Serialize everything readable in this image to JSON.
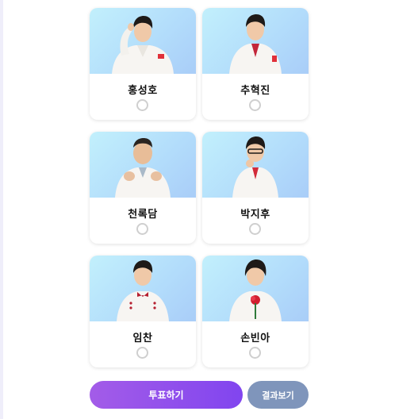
{
  "candidates": [
    {
      "name": "홍성호",
      "photo_icon": "candidate-photo",
      "selected": false
    },
    {
      "name": "추혁진",
      "photo_icon": "candidate-photo",
      "selected": false
    },
    {
      "name": "천록담",
      "photo_icon": "candidate-photo",
      "selected": false
    },
    {
      "name": "박지후",
      "photo_icon": "candidate-photo",
      "selected": false
    },
    {
      "name": "임찬",
      "photo_icon": "candidate-photo",
      "selected": false
    },
    {
      "name": "손빈아",
      "photo_icon": "candidate-photo",
      "selected": false
    }
  ],
  "actions": {
    "vote_label": "투표하기",
    "result_label": "결과보기"
  },
  "colors": {
    "photo_bg": "#b2dcfb",
    "vote_gradient_start": "#a35ce8",
    "vote_gradient_end": "#8145ef",
    "result_button": "#7f95bb",
    "radio_border": "#cfcfcf"
  }
}
